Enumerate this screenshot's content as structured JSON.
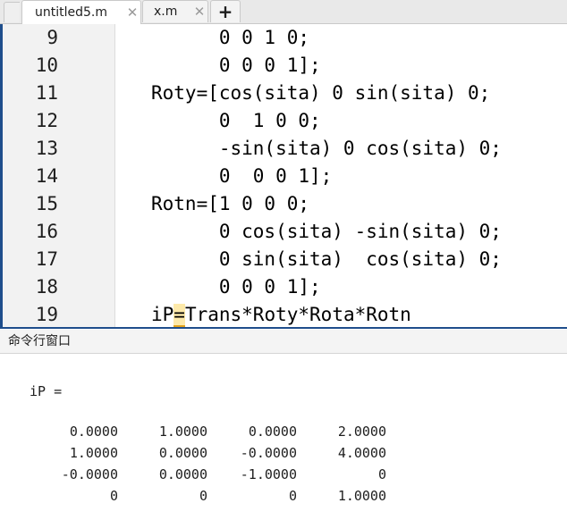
{
  "tabs": [
    {
      "label": "untitled5.m",
      "active": true,
      "close_glyph": "✕"
    },
    {
      "label": "x.m",
      "active": false,
      "close_glyph": "✕"
    }
  ],
  "add_tab_glyph": "+",
  "editor": {
    "lines": [
      {
        "num": "9",
        "text": "      0 0 1 0;"
      },
      {
        "num": "10",
        "text": "      0 0 0 1];"
      },
      {
        "num": "11",
        "text": "Roty=[cos(sita) 0 sin(sita) 0;"
      },
      {
        "num": "12",
        "text": "      0  1 0 0;"
      },
      {
        "num": "13",
        "text": "      -sin(sita) 0 cos(sita) 0;"
      },
      {
        "num": "14",
        "text": "      0  0 0 1];"
      },
      {
        "num": "15",
        "text": "Rotn=[1 0 0 0;"
      },
      {
        "num": "16",
        "text": "      0 cos(sita) -sin(sita) 0;"
      },
      {
        "num": "17",
        "text": "      0 sin(sita)  cos(sita) 0;"
      },
      {
        "num": "18",
        "text": "      0 0 0 1];"
      }
    ],
    "last_line": {
      "num": "19",
      "before": "iP",
      "marked": "=",
      "after": "Trans*Roty*Rota*Rotn"
    }
  },
  "command_window": {
    "title": "命令行窗口",
    "variable_line": "iP =",
    "matrix": [
      [
        "0.0000",
        "1.0000",
        "0.0000",
        "2.0000"
      ],
      [
        "1.0000",
        "0.0000",
        "-0.0000",
        "4.0000"
      ],
      [
        "-0.0000",
        "0.0000",
        "-1.0000",
        "0"
      ],
      [
        "0",
        "0",
        "0",
        "1.0000"
      ]
    ]
  },
  "colors": {
    "accent": "#1f4e8c",
    "cursor_highlight": "#fde9a9",
    "cursor_underline": "#e3a21a"
  }
}
